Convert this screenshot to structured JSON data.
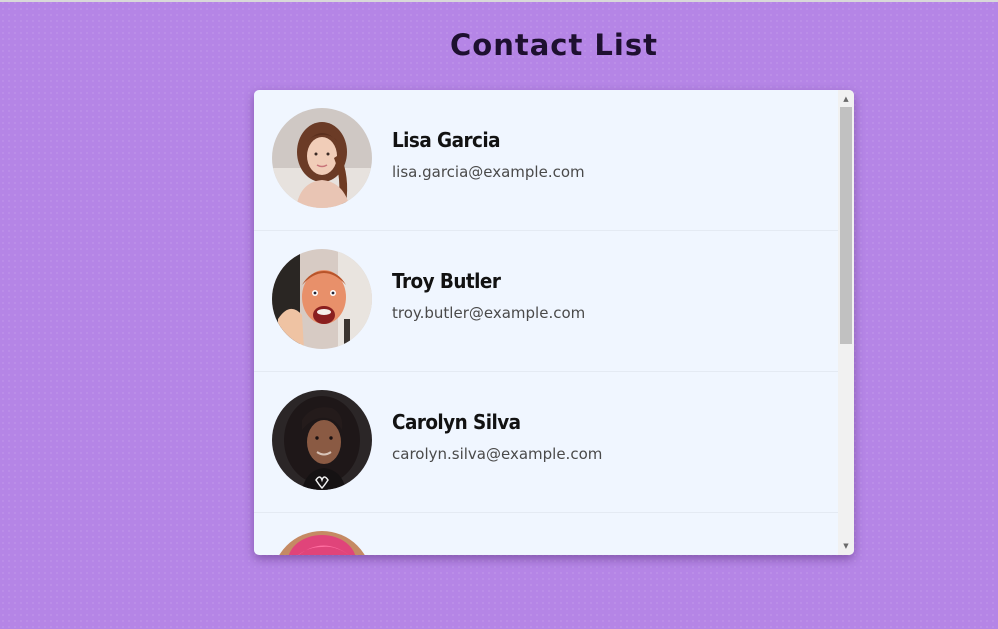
{
  "page": {
    "title": "Contact List"
  },
  "contacts": [
    {
      "name": "Lisa Garcia",
      "email": "lisa.garcia@example.com"
    },
    {
      "name": "Troy Butler",
      "email": "troy.butler@example.com"
    },
    {
      "name": "Carolyn Silva",
      "email": "carolyn.silva@example.com"
    },
    {
      "name": "",
      "email": ""
    }
  ],
  "scrollbar": {
    "up_icon": "▲",
    "down_icon": "▼",
    "scroll_fraction": 0.0
  },
  "colors": {
    "background": "#b585e6",
    "panel": "#f0f6ff",
    "title": "#1e1030"
  }
}
